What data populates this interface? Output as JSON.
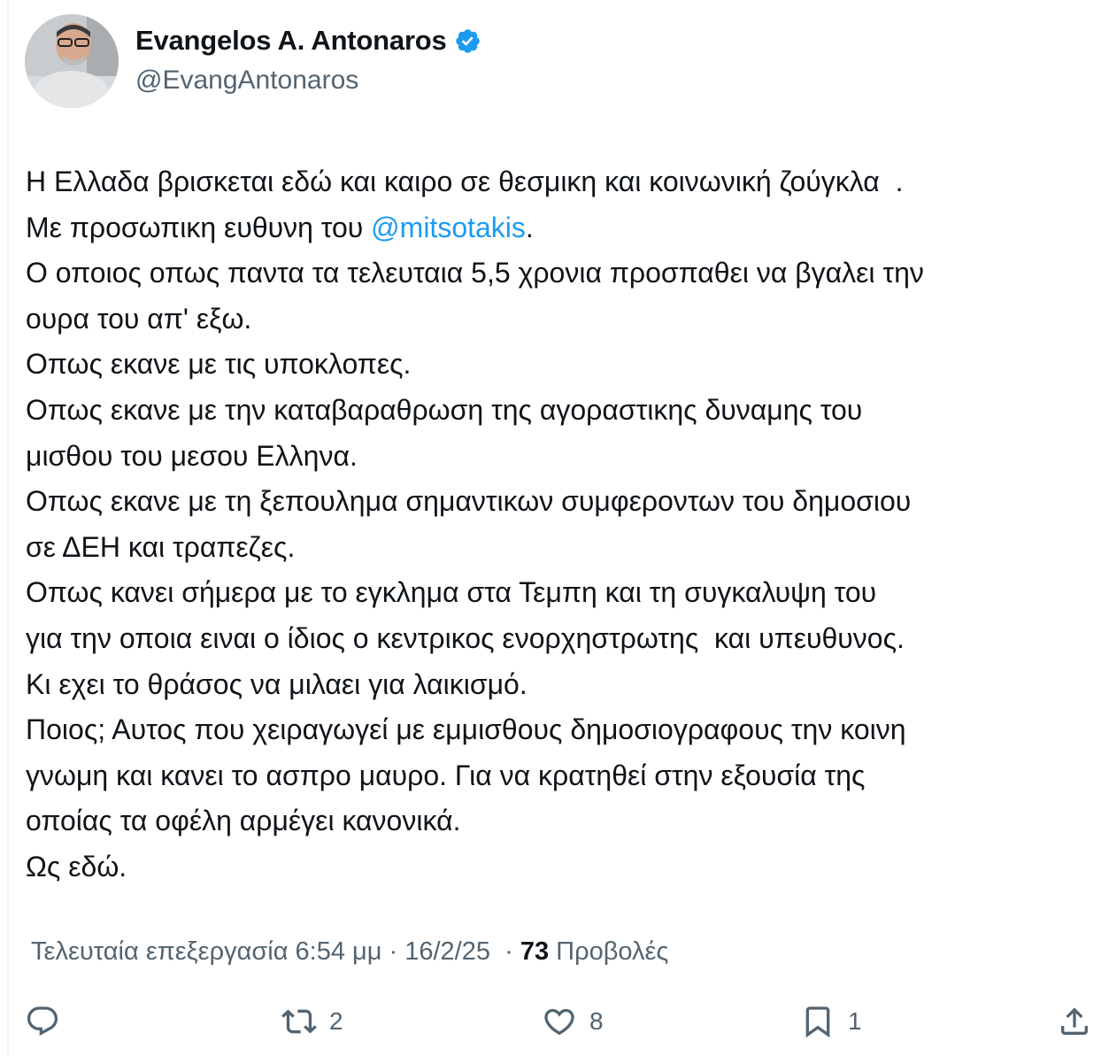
{
  "author": {
    "display_name": "Evangelos A. Antonaros",
    "handle": "@EvangAntonaros",
    "verified_icon": "verified-badge-icon",
    "accent_color": "#1d9bf0"
  },
  "tweet": {
    "lines": [
      {
        "pre": "Η Ελλαδα βρισκεται εδώ και καιρο σε θεσμικη και κοινωνική ζούγκλα  .",
        "mention": "",
        "post": ""
      },
      {
        "pre": "Με προσωπικη ευθυνη του ",
        "mention": "@mitsotakis",
        "post": "."
      },
      {
        "pre": "Ο οποιος οπως παντα τα τελευταια 5,5 χρονια προσπαθει να βγαλει την",
        "mention": "",
        "post": ""
      },
      {
        "pre": "ουρα του απ' εξω.",
        "mention": "",
        "post": ""
      },
      {
        "pre": "Οπως εκανε με τις υποκλοπες.",
        "mention": "",
        "post": ""
      },
      {
        "pre": "Οπως εκανε με την καταβαραθρωση της αγοραστικης δυναμης του",
        "mention": "",
        "post": ""
      },
      {
        "pre": "μισθου του μεσου Ελληνα.",
        "mention": "",
        "post": ""
      },
      {
        "pre": "Οπως εκανε με τη ξεπουλημα σημαντικων συμφεροντων του δημοσιου",
        "mention": "",
        "post": ""
      },
      {
        "pre": "σε ΔΕΗ και τραπεζες.",
        "mention": "",
        "post": ""
      },
      {
        "pre": "Οπως κανει σήμερα με το εγκλημα στα Τεμπη και τη συγκαλυψη του",
        "mention": "",
        "post": ""
      },
      {
        "pre": "για την οποια ειναι ο ίδιος ο κεντρικος ενορχηστρωτης  και υπευθυνος.",
        "mention": "",
        "post": ""
      },
      {
        "pre": "Κι εχει το θράσος να μιλαει για λαικισμό.",
        "mention": "",
        "post": ""
      },
      {
        "pre": "Ποιος; Αυτος που χειραγωγεί με εμμισθους δημοσιογραφους την κοινη",
        "mention": "",
        "post": ""
      },
      {
        "pre": "γνωμη και κανει το ασπρο μαυρο. Για να κρατηθεί στην εξουσία της",
        "mention": "",
        "post": ""
      },
      {
        "pre": "οποίας τα οφέλη αρμέγει κανονικά.",
        "mention": "",
        "post": ""
      },
      {
        "pre": "Ως εδώ.",
        "mention": "",
        "post": ""
      }
    ]
  },
  "meta": {
    "edited_label": "Τελευταία επεξεργασία 6:54 μμ",
    "separator1": " · ",
    "date": "16/2/25",
    "separator2": "  · ",
    "views_count": "73",
    "views_label": " Προβολές"
  },
  "actions": {
    "reply": {
      "icon": "reply-icon",
      "count": ""
    },
    "retweet": {
      "icon": "retweet-icon",
      "count": "2"
    },
    "like": {
      "icon": "heart-icon",
      "count": "8"
    },
    "bookmark": {
      "icon": "bookmark-icon",
      "count": "1"
    },
    "share": {
      "icon": "share-icon",
      "count": ""
    }
  }
}
